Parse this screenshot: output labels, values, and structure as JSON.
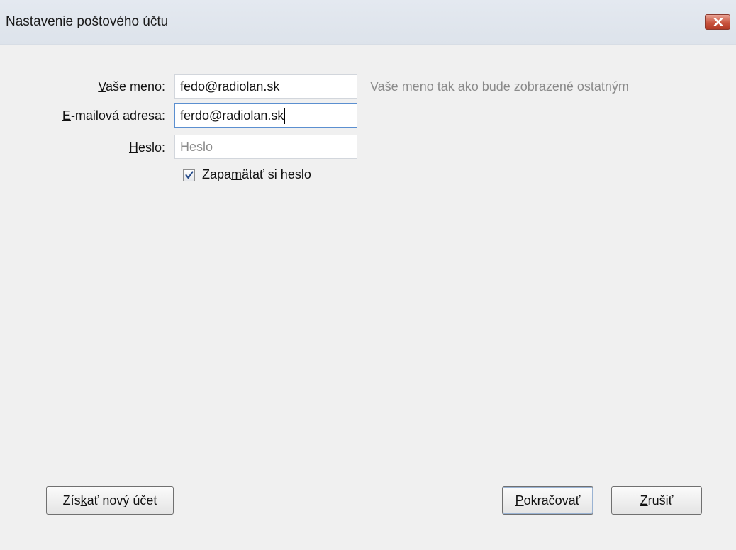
{
  "window": {
    "title": "Nastavenie poštového účtu"
  },
  "form": {
    "name_label_underlined": "V",
    "name_label_rest": "aše meno:",
    "name_value": "fedo@radiolan.sk",
    "name_hint": "Vaše meno tak ako bude zobrazené ostatným",
    "email_label_underlined": "E",
    "email_label_rest": "-mailová adresa:",
    "email_value": "ferdo@radiolan.sk",
    "password_label_underlined": "H",
    "password_label_rest": "eslo:",
    "password_placeholder": "Heslo",
    "remember_label_before": "Zapa",
    "remember_label_underlined": "m",
    "remember_label_after": "ätať si heslo",
    "remember_checked": true
  },
  "buttons": {
    "get_account_before": "Zís",
    "get_account_underlined": "k",
    "get_account_after": "ať nový účet",
    "continue_underlined": "P",
    "continue_rest": "okračovať",
    "cancel_underlined": "Z",
    "cancel_rest": "rušiť"
  },
  "icons": {
    "close": "close-icon",
    "check": "checkmark-icon"
  },
  "colors": {
    "close_button": "#c9543f",
    "focus_border": "#5b8fd0",
    "check_mark": "#2b4f8c"
  }
}
